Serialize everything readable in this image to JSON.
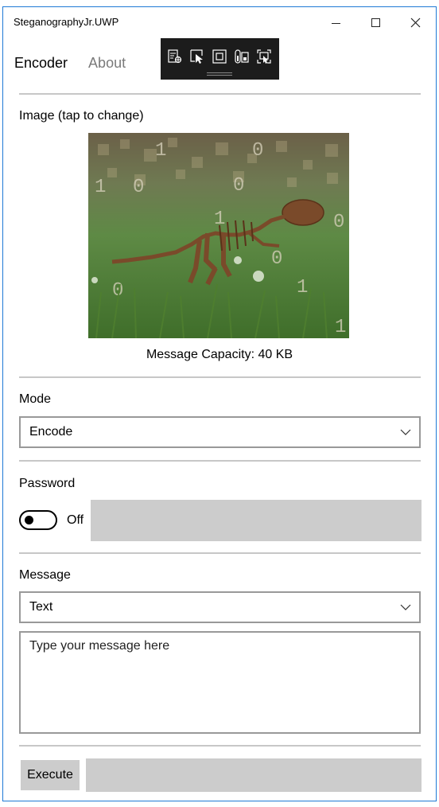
{
  "window": {
    "title": "SteganographyJr.UWP"
  },
  "pivot": {
    "items": [
      {
        "label": "Encoder",
        "active": true
      },
      {
        "label": "About",
        "active": false
      }
    ]
  },
  "devtools": {
    "icons": [
      "live-visual-tree-icon",
      "select-element-icon",
      "layout-adorners-icon",
      "track-focus-icon",
      "display-layout-icon"
    ]
  },
  "image_section": {
    "label": "Image (tap to change)",
    "capacity_text": "Message Capacity: 40 KB"
  },
  "mode": {
    "label": "Mode",
    "selected": "Encode"
  },
  "password": {
    "label": "Password",
    "toggle_state": "Off",
    "value": ""
  },
  "message": {
    "label": "Message",
    "type_selected": "Text",
    "placeholder": "Type your message here"
  },
  "footer": {
    "execute_label": "Execute",
    "status_text": ""
  },
  "colors": {
    "window_border": "#1e7ad6",
    "field_gray": "#cccccc",
    "divider": "#c7c7c7",
    "inactive_tab": "#7a7a7a"
  }
}
